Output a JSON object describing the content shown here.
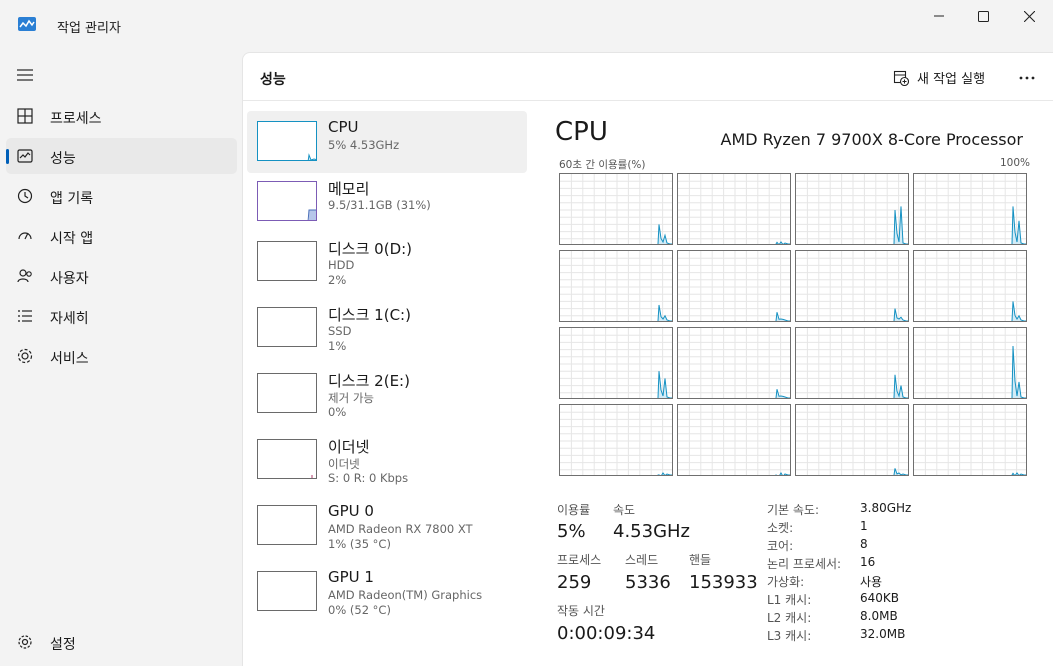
{
  "app": {
    "title": "작업 관리자"
  },
  "sidebar": {
    "items": [
      {
        "label": "프로세스",
        "icon": "processes-icon"
      },
      {
        "label": "성능",
        "icon": "performance-icon",
        "active": true
      },
      {
        "label": "앱 기록",
        "icon": "app-history-icon"
      },
      {
        "label": "시작 앱",
        "icon": "startup-apps-icon"
      },
      {
        "label": "사용자",
        "icon": "users-icon"
      },
      {
        "label": "자세히",
        "icon": "details-icon"
      },
      {
        "label": "서비스",
        "icon": "services-icon"
      }
    ],
    "settings_label": "설정"
  },
  "header": {
    "title": "성능",
    "run_task_label": "새 작업 실행"
  },
  "resources": [
    {
      "name": "CPU",
      "lines": [
        "5% 4.53GHz"
      ]
    },
    {
      "name": "메모리",
      "lines": [
        "9.5/31.1GB (31%)"
      ]
    },
    {
      "name": "디스크 0(D:)",
      "lines": [
        "HDD",
        "2%"
      ]
    },
    {
      "name": "디스크 1(C:)",
      "lines": [
        "SSD",
        "1%"
      ]
    },
    {
      "name": "디스크 2(E:)",
      "lines": [
        "제거 가능",
        "0%"
      ]
    },
    {
      "name": "이더넷",
      "lines": [
        "이더넷",
        "S: 0 R: 0 Kbps"
      ]
    },
    {
      "name": "GPU 0",
      "lines": [
        "AMD Radeon RX 7800 XT",
        "1% (35 °C)"
      ]
    },
    {
      "name": "GPU 1",
      "lines": [
        "AMD Radeon(TM) Graphics",
        "0% (52 °C)"
      ]
    }
  ],
  "detail": {
    "title": "CPU",
    "model": "AMD Ryzen 7 9700X 8-Core Processor",
    "graph_label": "60초 간 이용률(%)",
    "graph_max": "100%",
    "stats": {
      "utilization_label": "이용률",
      "utilization_value": "5%",
      "speed_label": "속도",
      "speed_value": "4.53GHz",
      "processes_label": "프로세스",
      "processes_value": "259",
      "threads_label": "스레드",
      "threads_value": "5336",
      "handles_label": "핸들",
      "handles_value": "153933",
      "uptime_label": "작동 시간",
      "uptime_value": "0:00:09:34"
    },
    "specs": [
      {
        "label": "기본 속도:",
        "value": "3.80GHz"
      },
      {
        "label": "소켓:",
        "value": "1"
      },
      {
        "label": "코어:",
        "value": "8"
      },
      {
        "label": "논리 프로세서:",
        "value": "16"
      },
      {
        "label": "가상화:",
        "value": "사용"
      },
      {
        "label": "L1 캐시:",
        "value": "640KB"
      },
      {
        "label": "L2 캐시:",
        "value": "8.0MB"
      },
      {
        "label": "L3 캐시:",
        "value": "32.0MB"
      }
    ]
  },
  "colors": {
    "accent": "#005fb8",
    "graph_line": "#1591c2",
    "graph_fill": "#d3ecf7"
  }
}
